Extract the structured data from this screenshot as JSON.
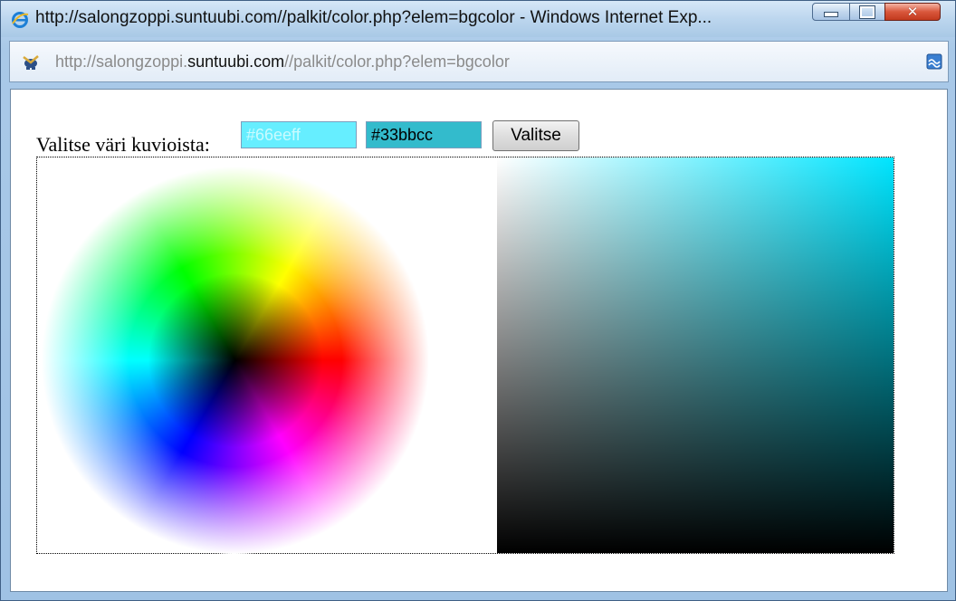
{
  "window": {
    "title": "http://salongzoppi.suntuubi.com//palkit/color.php?elem=bgcolor - Windows Internet Exp...",
    "icon": "ie-icon"
  },
  "address_bar": {
    "url_prefix": "http://salongzoppi.",
    "url_domain": "suntuubi.com",
    "url_suffix": "//palkit/color.php?elem=bgcolor",
    "icon": "site-icon"
  },
  "picker": {
    "label": "Valitse väri kuvioista:",
    "preview_value": "#66eeff",
    "current_value": "#33bbcc",
    "button_label": "Valitse"
  },
  "colors": {
    "preview": "#66eeff",
    "current": "#33bbcc",
    "square_hue": "#00e5ff"
  }
}
